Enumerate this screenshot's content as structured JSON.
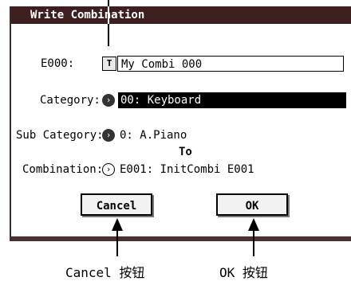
{
  "dialog": {
    "title": "Write Combination",
    "name_label": "E000:",
    "name_value": "My Combi 000",
    "text_edit_icon": "T",
    "category_label": "Category:",
    "category_value": "00: Keyboard",
    "subcategory_label": "Sub Category:",
    "subcategory_value": "0: A.Piano",
    "to_label": "To",
    "combination_label": "Combination:",
    "combination_value": "E001: InitCombi E001",
    "cancel_label": "Cancel",
    "ok_label": "OK"
  },
  "icons": {
    "popup_button": "chevron-right-icon",
    "text_edit": "text-edit-icon"
  },
  "annotations": {
    "cancel_caption": "Cancel 按钮",
    "ok_caption": "OK 按钮"
  },
  "colors": {
    "titlebar": "#3d1f1f",
    "selected_field": "#000000"
  }
}
